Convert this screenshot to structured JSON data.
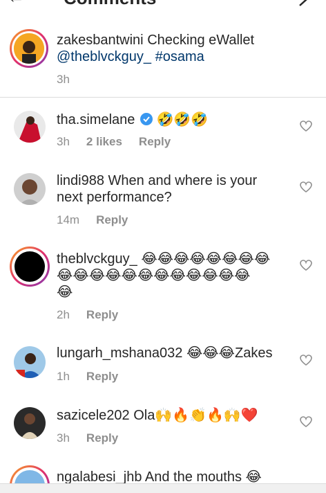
{
  "header": {
    "title": "Comments"
  },
  "caption": {
    "username": "zakesbantwini",
    "text": "Checking eWallet",
    "mention": "@theblvckguy_",
    "hashtag": "#osama",
    "time": "3h"
  },
  "comments": [
    {
      "username": "tha.simelane",
      "verified": true,
      "text": "🤣🤣🤣",
      "time": "3h",
      "likes": "2 likes",
      "reply": "Reply"
    },
    {
      "username": "lindi988",
      "text": "When and where is your",
      "text2": "next performance?",
      "time": "14m",
      "reply": "Reply"
    },
    {
      "username": "theblvckguy_",
      "text": "😂😂😂😂😂😂😂😂",
      "text2": "😂😂😂😂😂😂😂😂😂😂😂😂",
      "text3": "😂",
      "time": "2h",
      "reply": "Reply"
    },
    {
      "username": "lungarh_mshana032",
      "text": "😂😂😂Zakes",
      "time": "1h",
      "reply": "Reply"
    },
    {
      "username": "sazicele202",
      "text": "Ola🙌🔥👏🔥🙌❤️",
      "time": "3h",
      "reply": "Reply"
    },
    {
      "username": "ngalabesi_jhb",
      "text": "And the mouths 😂"
    }
  ],
  "colors": {
    "link": "#00376b",
    "verified": "#3897f0",
    "meta": "#8e8e8e",
    "ring": "#e1306c"
  }
}
